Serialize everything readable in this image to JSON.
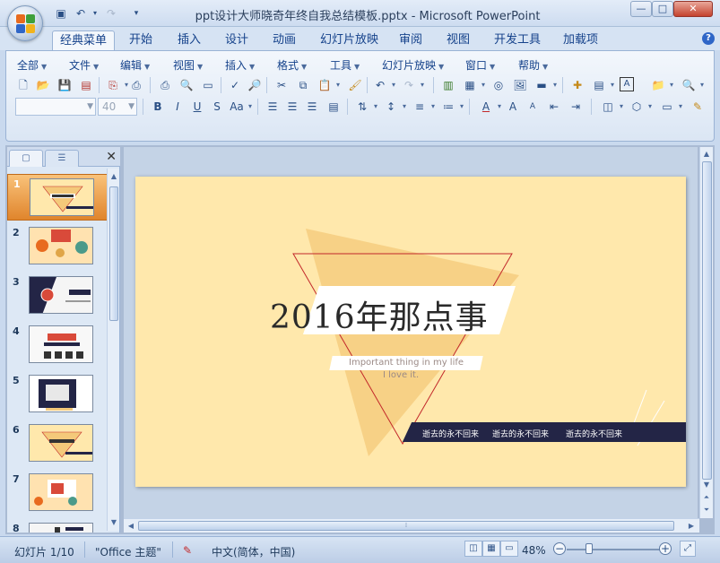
{
  "window": {
    "title": "ppt设计大师晓奇年终自我总结模板.pptx - Microsoft PowerPoint",
    "minimize": "—",
    "maximize": "□",
    "close": "✕"
  },
  "quick_access": {
    "save_icon": "save-icon",
    "undo_icon": "undo-icon",
    "redo_icon": "redo-icon"
  },
  "tabs": [
    "经典菜单",
    "开始",
    "插入",
    "设计",
    "动画",
    "幻灯片放映",
    "审阅",
    "视图",
    "开发工具",
    "加载项"
  ],
  "active_tab": "经典菜单",
  "menus": [
    "全部",
    "文件",
    "编辑",
    "视图",
    "插入",
    "格式",
    "工具",
    "幻灯片放映",
    "窗口",
    "帮助"
  ],
  "formatting": {
    "font_name": "",
    "font_size": "40"
  },
  "thumbnails": [
    {
      "num": "1",
      "selected": true
    },
    {
      "num": "2",
      "selected": false
    },
    {
      "num": "3",
      "selected": false
    },
    {
      "num": "4",
      "selected": false
    },
    {
      "num": "5",
      "selected": false
    },
    {
      "num": "6",
      "selected": false
    },
    {
      "num": "7",
      "selected": false
    },
    {
      "num": "8",
      "selected": false
    }
  ],
  "slide": {
    "title": "2016年那点事",
    "subtitle1": "Important thing in my life",
    "subtitle2": "I love it.",
    "band_texts": [
      "逝去的永不回来",
      "逝去的永不回来",
      "逝去的永不回来"
    ],
    "colors": {
      "background": "#ffe8ac",
      "accent": "#f4c97a",
      "outline": "#c2282a",
      "band": "#232546"
    }
  },
  "status": {
    "slide_info": "幻灯片 1/10",
    "theme": "\"Office 主题\"",
    "language": "中文(简体，中国)",
    "zoom": "48%",
    "zoom_level_fraction": 0.48
  }
}
